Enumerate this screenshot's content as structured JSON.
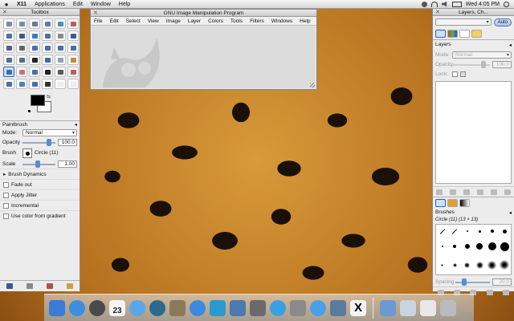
{
  "menubar": {
    "apple": "",
    "items": [
      "X11",
      "Applications",
      "Edit",
      "Window",
      "Help"
    ],
    "clock": "Wed 4:05 PM"
  },
  "toolbox": {
    "title": "Toolbox",
    "tools": [
      {
        "icon": "rect-select-icon",
        "color": "#7a8aa0"
      },
      {
        "icon": "ellipse-select-icon",
        "color": "#7a8aa0"
      },
      {
        "icon": "free-select-icon",
        "color": "#6a7a90"
      },
      {
        "icon": "fuzzy-select-icon",
        "color": "#5a7ab0"
      },
      {
        "icon": "select-by-color-icon",
        "color": "#4a90c0"
      },
      {
        "icon": "scissors-icon",
        "color": "#c05a5a"
      },
      {
        "icon": "foreground-select-icon",
        "color": "#4a6fa5"
      },
      {
        "icon": "paths-icon",
        "color": "#3a5a90"
      },
      {
        "icon": "color-picker-icon",
        "color": "#3b7bc4"
      },
      {
        "icon": "zoom-icon",
        "color": "#4a6fa5"
      },
      {
        "icon": "measure-icon",
        "color": "#8a8a8a"
      },
      {
        "icon": "move-icon",
        "color": "#3a5a90"
      },
      {
        "icon": "align-icon",
        "color": "#5a5a8a"
      },
      {
        "icon": "crop-icon",
        "color": "#666666"
      },
      {
        "icon": "rotate-icon",
        "color": "#4a6fa5"
      },
      {
        "icon": "scale-icon",
        "color": "#4a6fa5"
      },
      {
        "icon": "shear-icon",
        "color": "#4a6fa5"
      },
      {
        "icon": "perspective-icon",
        "color": "#4a6fa5"
      },
      {
        "icon": "flip-icon",
        "color": "#4a6fa5"
      },
      {
        "icon": "cage-icon",
        "color": "#5a6a80"
      },
      {
        "icon": "text-icon",
        "color": "#222222"
      },
      {
        "icon": "bucket-fill-icon",
        "color": "#3a6ab0"
      },
      {
        "icon": "blend-icon",
        "color": "#8aa0c0"
      },
      {
        "icon": "pencil-icon",
        "color": "#c08a3a"
      },
      {
        "icon": "paintbrush-icon",
        "color": "#3a6ab0"
      },
      {
        "icon": "eraser-icon",
        "color": "#d07070"
      },
      {
        "icon": "airbrush-icon",
        "color": "#4a6fa5"
      },
      {
        "icon": "ink-icon",
        "color": "#222222"
      },
      {
        "icon": "clone-icon",
        "color": "#5a5a5a"
      },
      {
        "icon": "heal-icon",
        "color": "#c05a5a"
      },
      {
        "icon": "perspective-clone-icon",
        "color": "#4a6fa5"
      },
      {
        "icon": "blur-icon",
        "color": "#4a80c0"
      },
      {
        "icon": "smudge-icon",
        "color": "#4a6fa5"
      },
      {
        "icon": "dodge-burn-icon",
        "color": "#333333"
      },
      {
        "icon": "placeholder-icon",
        "color": "#ececec"
      },
      {
        "icon": "placeholder-icon",
        "color": "#ececec"
      }
    ],
    "active_tool_index": 24,
    "colors": {
      "foreground": "#000000",
      "background": "#ffffff"
    },
    "options": {
      "header": "Paintbrush",
      "mode_label": "Mode:",
      "mode_value": "Normal",
      "opacity_label": "Opacity",
      "opacity_value": "100.0",
      "brush_label": "Brush",
      "brush_value": "Circle (11)",
      "scale_label": "Scale",
      "scale_value": "1.00",
      "dynamics_label": "Brush Dynamics",
      "fade_label": "Fade out",
      "jitter_label": "Apply Jitter",
      "incremental_label": "Incremental",
      "gradient_label": "Use color from gradient"
    }
  },
  "gimp_window": {
    "title": "GNU Image Manipulation Program",
    "menu": [
      "File",
      "Edit",
      "Select",
      "View",
      "Image",
      "Layer",
      "Colors",
      "Tools",
      "Filters",
      "Windows",
      "Help"
    ]
  },
  "dock": {
    "title": "Layers, Ch...",
    "auto_label": "Auto",
    "layers_label": "Layers",
    "mode_label": "Mode:",
    "mode_value": "Normal",
    "opacity_label": "Opacity",
    "opacity_value": "100.0",
    "lock_label": "Lock:",
    "brushes_label": "Brushes",
    "brush_name": "Circle (11) (13 × 13)",
    "spacing_label": "Spacing",
    "spacing_value": "20.0"
  },
  "macdock": {
    "apps": [
      {
        "name": "finder-icon",
        "color": "#3a7bd5",
        "shape": "square"
      },
      {
        "name": "app-store-icon",
        "color": "#3b8ee0",
        "shape": "round"
      },
      {
        "name": "dashboard-icon",
        "color": "#4a4a4a",
        "shape": "round"
      },
      {
        "name": "ical-icon",
        "color": "#f4f4f4",
        "shape": "square",
        "label": "23"
      },
      {
        "name": "safari-icon",
        "color": "#5aa6e8",
        "shape": "round"
      },
      {
        "name": "time-machine-icon",
        "color": "#2a6a8a",
        "shape": "round"
      },
      {
        "name": "gimp-icon",
        "color": "#8a7a5a",
        "shape": "square"
      },
      {
        "name": "itunes-icon",
        "color": "#3a8ae0",
        "shape": "round"
      },
      {
        "name": "wave-app-icon",
        "color": "#2a9ad0",
        "shape": "square"
      },
      {
        "name": "zoo-app-icon",
        "color": "#4a7ab0",
        "shape": "square"
      },
      {
        "name": "vmware-icon",
        "color": "#6a6a6a",
        "shape": "square"
      },
      {
        "name": "network-icon",
        "color": "#3aa0e0",
        "shape": "round"
      },
      {
        "name": "preview-icon",
        "color": "#8a8a8a",
        "shape": "square"
      },
      {
        "name": "icloud-icon",
        "color": "#4aa0e8",
        "shape": "round"
      },
      {
        "name": "photo-app-icon",
        "color": "#5a7aa0",
        "shape": "square"
      },
      {
        "name": "x11-icon",
        "color": "#f4f4f4",
        "shape": "square",
        "label": "X"
      }
    ],
    "docs": [
      {
        "name": "applications-folder-icon",
        "color": "#6a9ad0"
      },
      {
        "name": "documents-stack-icon",
        "color": "#c8d4e0"
      },
      {
        "name": "downloads-stack-icon",
        "color": "#e8e8e8"
      },
      {
        "name": "trash-icon",
        "color": "#b8bcc0"
      }
    ]
  }
}
